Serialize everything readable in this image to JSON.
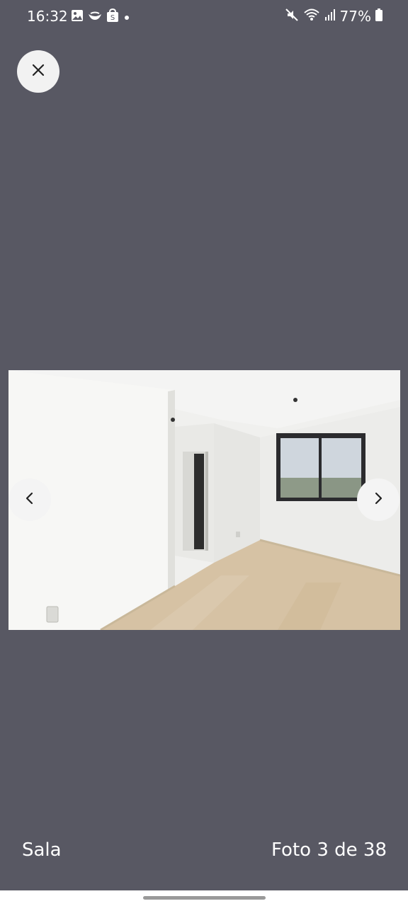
{
  "status_bar": {
    "time": "16:32",
    "left_icons": [
      "gallery-icon",
      "bird-app-icon",
      "shopping-bag-icon",
      "dot-icon"
    ],
    "right_icons": [
      "mute-icon",
      "wifi-icon",
      "signal-icon",
      "battery-icon"
    ],
    "battery": "77%"
  },
  "viewer": {
    "close_icon": "close-icon",
    "prev_icon": "chevron-left-icon",
    "next_icon": "chevron-right-icon",
    "caption": "Sala",
    "counter": "Foto 3 de 38"
  },
  "colors": {
    "background": "#585863",
    "button_bg": "#f2f2f2",
    "text": "#ffffff"
  }
}
